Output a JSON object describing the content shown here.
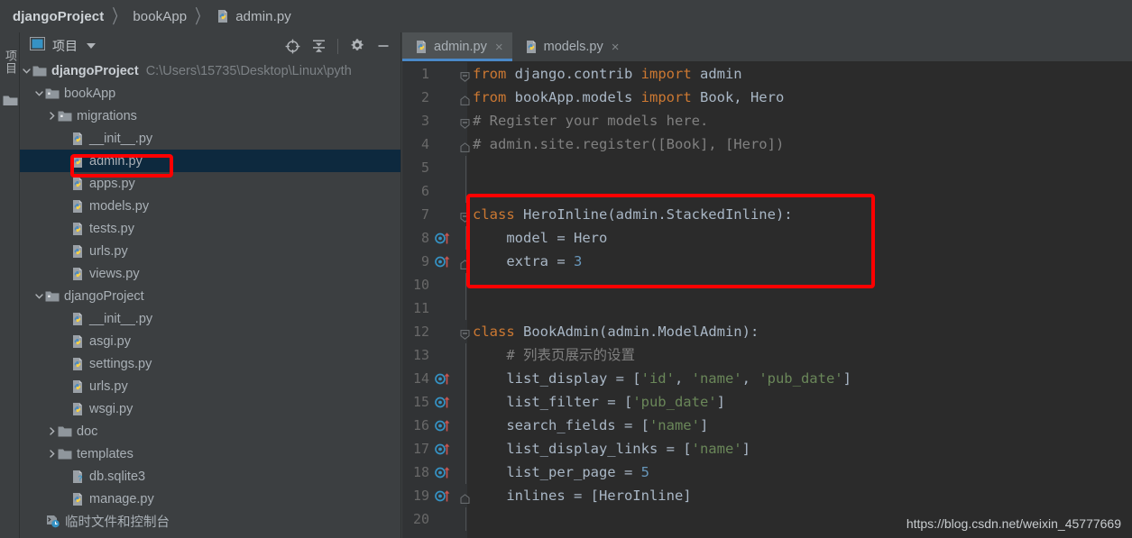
{
  "breadcrumb": {
    "items": [
      {
        "label": "djangoProject",
        "icon": "none",
        "bold": true
      },
      {
        "label": "bookApp",
        "icon": "none",
        "bold": false
      },
      {
        "label": "admin.py",
        "icon": "python-file-icon",
        "bold": false
      }
    ],
    "separator": "〉"
  },
  "tool_strip": {
    "vertical_tab_label": "项目",
    "folder_icon": "folder-icon"
  },
  "project_panel": {
    "title": "项目",
    "title_icon": "project-view-icon",
    "caret_icon": "chevron-down-icon",
    "tools": [
      {
        "name": "locate-icon",
        "label": "定位"
      },
      {
        "name": "collapse-all-icon",
        "label": "折叠全部"
      },
      {
        "name": "gear-icon",
        "label": "设置"
      },
      {
        "name": "minimize-icon",
        "label": "最小化"
      }
    ],
    "tree": [
      {
        "label": "djangoProject",
        "path": "C:\\Users\\15735\\Desktop\\Linux\\pyth",
        "indent": 0,
        "twisty": "down",
        "icon": "folder-icon",
        "bold": true,
        "selected": false
      },
      {
        "label": "bookApp",
        "path": "",
        "indent": 1,
        "twisty": "down",
        "icon": "module-folder-icon",
        "bold": false,
        "selected": false
      },
      {
        "label": "migrations",
        "path": "",
        "indent": 2,
        "twisty": "right",
        "icon": "module-folder-icon",
        "bold": false,
        "selected": false
      },
      {
        "label": "__init__.py",
        "path": "",
        "indent": 3,
        "twisty": "none",
        "icon": "python-file-icon",
        "bold": false,
        "selected": false
      },
      {
        "label": "admin.py",
        "path": "",
        "indent": 3,
        "twisty": "none",
        "icon": "python-file-icon",
        "bold": false,
        "selected": true
      },
      {
        "label": "apps.py",
        "path": "",
        "indent": 3,
        "twisty": "none",
        "icon": "python-file-icon",
        "bold": false,
        "selected": false
      },
      {
        "label": "models.py",
        "path": "",
        "indent": 3,
        "twisty": "none",
        "icon": "python-file-icon",
        "bold": false,
        "selected": false
      },
      {
        "label": "tests.py",
        "path": "",
        "indent": 3,
        "twisty": "none",
        "icon": "python-file-icon",
        "bold": false,
        "selected": false
      },
      {
        "label": "urls.py",
        "path": "",
        "indent": 3,
        "twisty": "none",
        "icon": "python-file-icon",
        "bold": false,
        "selected": false
      },
      {
        "label": "views.py",
        "path": "",
        "indent": 3,
        "twisty": "none",
        "icon": "python-file-icon",
        "bold": false,
        "selected": false
      },
      {
        "label": "djangoProject",
        "path": "",
        "indent": 1,
        "twisty": "down",
        "icon": "module-folder-icon",
        "bold": false,
        "selected": false
      },
      {
        "label": "__init__.py",
        "path": "",
        "indent": 3,
        "twisty": "none",
        "icon": "python-file-icon",
        "bold": false,
        "selected": false
      },
      {
        "label": "asgi.py",
        "path": "",
        "indent": 3,
        "twisty": "none",
        "icon": "python-file-icon",
        "bold": false,
        "selected": false
      },
      {
        "label": "settings.py",
        "path": "",
        "indent": 3,
        "twisty": "none",
        "icon": "python-file-icon",
        "bold": false,
        "selected": false
      },
      {
        "label": "urls.py",
        "path": "",
        "indent": 3,
        "twisty": "none",
        "icon": "python-file-icon",
        "bold": false,
        "selected": false
      },
      {
        "label": "wsgi.py",
        "path": "",
        "indent": 3,
        "twisty": "none",
        "icon": "python-file-icon",
        "bold": false,
        "selected": false
      },
      {
        "label": "doc",
        "path": "",
        "indent": 2,
        "twisty": "right",
        "icon": "folder-icon",
        "bold": false,
        "selected": false
      },
      {
        "label": "templates",
        "path": "",
        "indent": 2,
        "twisty": "right",
        "icon": "folder-icon",
        "bold": false,
        "selected": false
      },
      {
        "label": "db.sqlite3",
        "path": "",
        "indent": 3,
        "twisty": "none",
        "icon": "unknown-file-icon",
        "bold": false,
        "selected": false
      },
      {
        "label": "manage.py",
        "path": "",
        "indent": 3,
        "twisty": "none",
        "icon": "python-file-icon",
        "bold": false,
        "selected": false
      },
      {
        "label": "临时文件和控制台",
        "path": "",
        "indent": 1,
        "twisty": "none",
        "icon": "scratch-console-icon",
        "bold": false,
        "selected": false
      }
    ]
  },
  "editor": {
    "tabs": [
      {
        "label": "admin.py",
        "icon": "python-file-icon",
        "close": "×",
        "active": true
      },
      {
        "label": "models.py",
        "icon": "python-file-icon",
        "close": "×",
        "active": false
      }
    ],
    "lines": [
      {
        "n": "1",
        "fold": "minus",
        "gutter": "",
        "text": "from django.contrib import admin",
        "tokens": [
          {
            "t": "from ",
            "c": "kw"
          },
          {
            "t": "django.contrib ",
            "c": "def"
          },
          {
            "t": "import ",
            "c": "kw"
          },
          {
            "t": "admin",
            "c": "def"
          }
        ]
      },
      {
        "n": "2",
        "fold": "end",
        "gutter": "",
        "text": "from bookApp.models import Book, Hero",
        "tokens": [
          {
            "t": "from ",
            "c": "kw"
          },
          {
            "t": "bookApp.models ",
            "c": "def"
          },
          {
            "t": "import ",
            "c": "kw"
          },
          {
            "t": "Book, Hero",
            "c": "def"
          }
        ]
      },
      {
        "n": "3",
        "fold": "minus",
        "gutter": "",
        "text": "# Register your models here.",
        "tokens": [
          {
            "t": "# Register your models here.",
            "c": "cmt"
          }
        ]
      },
      {
        "n": "4",
        "fold": "end",
        "gutter": "",
        "text": "# admin.site.register([Book], [Hero])",
        "tokens": [
          {
            "t": "# admin.site.register([Book], [Hero])",
            "c": "cmt"
          }
        ]
      },
      {
        "n": "5",
        "fold": "",
        "gutter": "",
        "text": "",
        "tokens": []
      },
      {
        "n": "6",
        "fold": "",
        "gutter": "",
        "text": "",
        "tokens": []
      },
      {
        "n": "7",
        "fold": "minus",
        "gutter": "",
        "text": "class HeroInline(admin.StackedInline):",
        "tokens": [
          {
            "t": "class ",
            "c": "kw"
          },
          {
            "t": "HeroInline",
            "c": "def"
          },
          {
            "t": "(admin.StackedInline):",
            "c": "def"
          }
        ]
      },
      {
        "n": "8",
        "fold": "",
        "gutter": "override",
        "text": "    model = Hero",
        "tokens": [
          {
            "t": "    model = Hero",
            "c": "def"
          }
        ]
      },
      {
        "n": "9",
        "fold": "end",
        "gutter": "override",
        "text": "    extra = 3",
        "tokens": [
          {
            "t": "    extra = ",
            "c": "def"
          },
          {
            "t": "3",
            "c": "num"
          }
        ]
      },
      {
        "n": "10",
        "fold": "",
        "gutter": "",
        "text": "",
        "tokens": []
      },
      {
        "n": "11",
        "fold": "",
        "gutter": "",
        "text": "",
        "tokens": []
      },
      {
        "n": "12",
        "fold": "minus",
        "gutter": "",
        "text": "class BookAdmin(admin.ModelAdmin):",
        "tokens": [
          {
            "t": "class ",
            "c": "kw"
          },
          {
            "t": "BookAdmin",
            "c": "def"
          },
          {
            "t": "(admin.ModelAdmin):",
            "c": "def"
          }
        ]
      },
      {
        "n": "13",
        "fold": "",
        "gutter": "",
        "text": "    # 列表页展示的设置",
        "tokens": [
          {
            "t": "    # 列表页展示的设置",
            "c": "cmt"
          }
        ]
      },
      {
        "n": "14",
        "fold": "",
        "gutter": "override",
        "text": "    list_display = ['id', 'name', 'pub_date']",
        "tokens": [
          {
            "t": "    list_display = [",
            "c": "def"
          },
          {
            "t": "'id'",
            "c": "str"
          },
          {
            "t": ", ",
            "c": "def"
          },
          {
            "t": "'name'",
            "c": "str"
          },
          {
            "t": ", ",
            "c": "def"
          },
          {
            "t": "'pub_date'",
            "c": "str"
          },
          {
            "t": "]",
            "c": "def"
          }
        ]
      },
      {
        "n": "15",
        "fold": "",
        "gutter": "override",
        "text": "    list_filter = ['pub_date']",
        "tokens": [
          {
            "t": "    list_filter = [",
            "c": "def"
          },
          {
            "t": "'pub_date'",
            "c": "str"
          },
          {
            "t": "]",
            "c": "def"
          }
        ]
      },
      {
        "n": "16",
        "fold": "",
        "gutter": "override",
        "text": "    search_fields = ['name']",
        "tokens": [
          {
            "t": "    search_fields = [",
            "c": "def"
          },
          {
            "t": "'name'",
            "c": "str"
          },
          {
            "t": "]",
            "c": "def"
          }
        ]
      },
      {
        "n": "17",
        "fold": "",
        "gutter": "override",
        "text": "    list_display_links = ['name']",
        "tokens": [
          {
            "t": "    list_display_links = [",
            "c": "def"
          },
          {
            "t": "'name'",
            "c": "str"
          },
          {
            "t": "]",
            "c": "def"
          }
        ]
      },
      {
        "n": "18",
        "fold": "",
        "gutter": "override",
        "text": "    list_per_page = 5",
        "tokens": [
          {
            "t": "    list_per_page = ",
            "c": "def"
          },
          {
            "t": "5",
            "c": "num"
          }
        ]
      },
      {
        "n": "19",
        "fold": "end",
        "gutter": "override",
        "text": "    inlines = [HeroInline]",
        "tokens": [
          {
            "t": "    inlines = [HeroInline]",
            "c": "def"
          }
        ]
      },
      {
        "n": "20",
        "fold": "",
        "gutter": "",
        "text": "",
        "tokens": []
      }
    ]
  },
  "annotations": {
    "box_color": "#ff0000",
    "boxes": [
      {
        "name": "admin-py-tree-highlight"
      },
      {
        "name": "heroinline-code-highlight"
      }
    ]
  },
  "watermark": {
    "text": "https://blog.csdn.net/weixin_45777669"
  },
  "colors": {
    "chrome_bg": "#3c3f41",
    "editor_bg": "#2b2b2b",
    "gutter_bg": "#313335",
    "selection_bg": "#0d293e",
    "tab_active_bg": "#4e5254",
    "tab_underline": "#4a88c7",
    "keyword": "#cc7832",
    "string": "#6a8759",
    "number": "#6897bb",
    "comment": "#808080",
    "text": "#a9b7c6",
    "annotation": "#ff0000"
  }
}
